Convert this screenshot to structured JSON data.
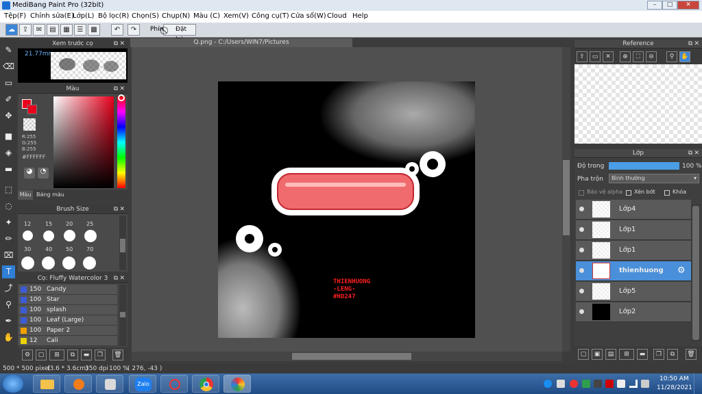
{
  "app": {
    "title": "MediBang Paint Pro (32bit)"
  },
  "menu": [
    "Tệp(F)",
    "Chỉnh sửa(E)",
    "Lớp(L)",
    "Bộ lọc(R)",
    "Chọn(S)",
    "Chụp(N)",
    "Màu (C)",
    "Xem(V)",
    "Công cụ(T)",
    "Cửa sổ(W)",
    "Cloud",
    "Help"
  ],
  "toolbar": {
    "brush_label": "Phím",
    "reset_label": "Đặt lại"
  },
  "preview_panel": {
    "title": "Xem trước cọ",
    "size": "21.77mm"
  },
  "color_panel": {
    "title": "Màu",
    "r": "R:255",
    "g": "G:255",
    "b": "B:255",
    "hex": "#FFFFFF",
    "tab_color": "Màu",
    "tab_palette": "Bảng màu",
    "primary_color": "#e8001c"
  },
  "brush_size_panel": {
    "title": "Brush Size",
    "row1": [
      "12",
      "15",
      "20",
      "25"
    ],
    "row2": [
      "30",
      "40",
      "50",
      "70"
    ]
  },
  "brush_panel": {
    "title": "Cọ: Fluffy Watercolor 3",
    "items": [
      {
        "size": "150",
        "name": "Candy",
        "color": "#3b5cd6"
      },
      {
        "size": "100",
        "name": "Star",
        "color": "#3b5cd6"
      },
      {
        "size": "100",
        "name": "splash",
        "color": "#3b5cd6"
      },
      {
        "size": "100",
        "name": "Leaf (Large)",
        "color": "#3b5cd6"
      },
      {
        "size": "100",
        "name": "Paper 2",
        "color": "#f2a100"
      },
      {
        "size": "12",
        "name": "Cali",
        "color": "#e8d200"
      }
    ]
  },
  "document": {
    "tab": "Q.png - C:/Users/WIN7/Pictures",
    "art_text": "THIENHUONG\n-LENG-\n#HD247"
  },
  "reference_panel": {
    "title": "Reference"
  },
  "layer_panel": {
    "title": "Lớp",
    "opacity_label": "Độ trong",
    "opacity_value": "100 %",
    "opacity_fraction": 1.0,
    "blend_label": "Pha trộn",
    "blend_value": "Bình thường",
    "protect_alpha": "Bảo vệ alpha",
    "clipping": "Xén bớt",
    "lock": "Khóa",
    "layers": [
      {
        "name": "Lớp4",
        "selected": false
      },
      {
        "name": "Lớp1",
        "selected": false
      },
      {
        "name": "Lớp1",
        "selected": false
      },
      {
        "name": "thienhuong",
        "selected": true
      },
      {
        "name": "Lớp5",
        "selected": false
      },
      {
        "name": "Lớp2",
        "selected": false
      }
    ]
  },
  "status": {
    "size": "500 * 500 pixel",
    "dims": "(3.6 * 3.6cm)",
    "dpi": "350 dpi",
    "zoom": "100 %",
    "coords": "( 276, -43 )"
  },
  "taskbar": {
    "zalo": "Zalo",
    "time": "10:50 AM",
    "date": "11/28/2021"
  }
}
